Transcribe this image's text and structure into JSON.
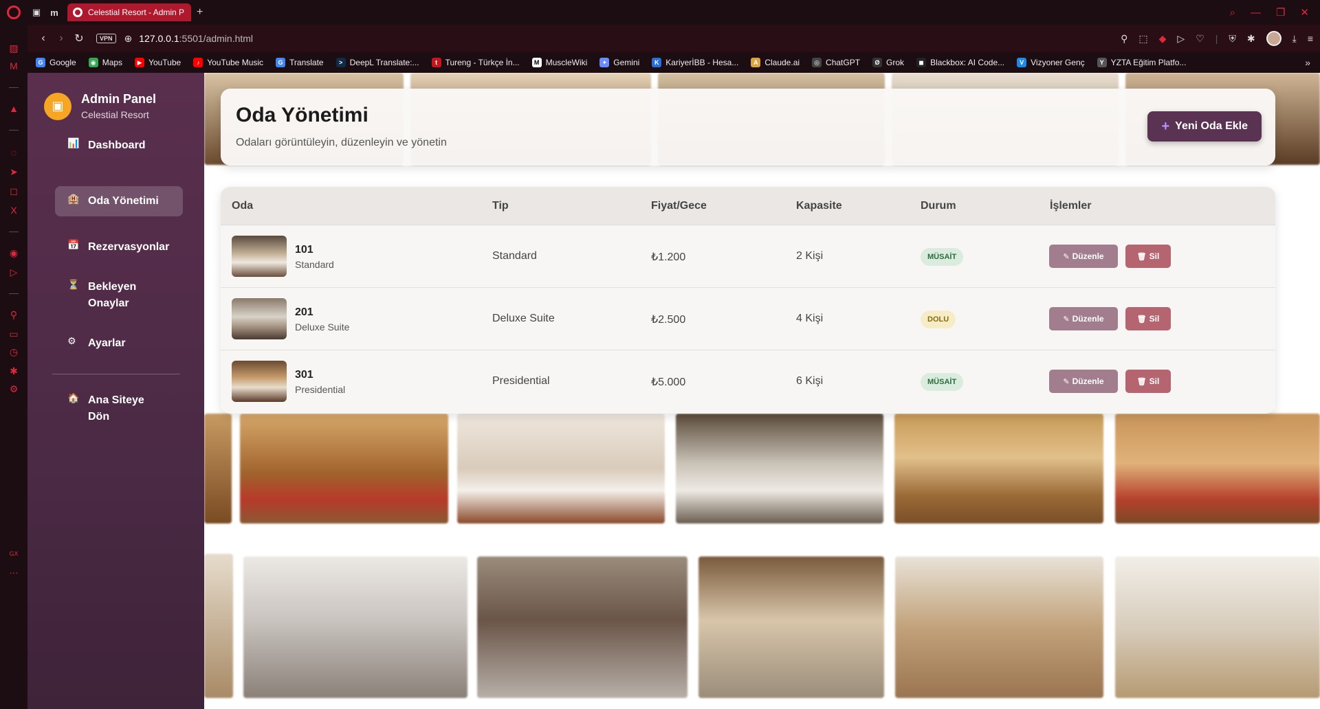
{
  "browser": {
    "tab_title": "Celestial Resort - Admin P",
    "url_host": "127.0.0.1",
    "url_rest": ":5501/admin.html",
    "vpn_label": "VPN",
    "bookmarks": [
      {
        "label": "Google",
        "color": "#4285f4",
        "glyph": "G"
      },
      {
        "label": "Maps",
        "color": "#34a853",
        "glyph": "◉"
      },
      {
        "label": "YouTube",
        "color": "#ff0000",
        "glyph": "▶"
      },
      {
        "label": "YouTube Music",
        "color": "#ff0000",
        "glyph": "♪"
      },
      {
        "label": "Translate",
        "color": "#4285f4",
        "glyph": "G"
      },
      {
        "label": "DeepL Translate:...",
        "color": "#0f2b46",
        "glyph": ">"
      },
      {
        "label": "Tureng - Türkçe İn...",
        "color": "#c4161c",
        "glyph": "t"
      },
      {
        "label": "MuscleWiki",
        "color": "#ffffff",
        "glyph": "M"
      },
      {
        "label": "Gemini",
        "color": "#6a8cff",
        "glyph": "✦"
      },
      {
        "label": "KariyerİBB - Hesa...",
        "color": "#2a6fd6",
        "glyph": "K"
      },
      {
        "label": "Claude.ai",
        "color": "#d9a441",
        "glyph": "A"
      },
      {
        "label": "ChatGPT",
        "color": "#444444",
        "glyph": "◎"
      },
      {
        "label": "Grok",
        "color": "#333333",
        "glyph": "Ø"
      },
      {
        "label": "Blackbox: AI Code...",
        "color": "#222222",
        "glyph": "◼"
      },
      {
        "label": "Vizyoner Genç",
        "color": "#1e88e5",
        "glyph": "V"
      },
      {
        "label": "YZTA Eğitim Platfo...",
        "color": "#555555",
        "glyph": "Y"
      }
    ]
  },
  "sidebar": {
    "title": "Admin Panel",
    "subtitle": "Celestial Resort",
    "items": [
      {
        "label": "Dashboard",
        "icon": "📊"
      },
      {
        "label": "Oda Yönetimi",
        "icon": "🏨"
      },
      {
        "label": "Rezervasyonlar",
        "icon": "📅"
      },
      {
        "label": "Bekleyen Onaylar",
        "icon": "⏳"
      },
      {
        "label": "Ayarlar",
        "icon": "⚙"
      },
      {
        "label": "Ana Siteye Dön",
        "icon": "🏠"
      }
    ]
  },
  "header": {
    "title": "Oda Yönetimi",
    "subtitle": "Odaları görüntüleyin, düzenleyin ve yönetin",
    "add_button": "Yeni Oda Ekle"
  },
  "table": {
    "columns": [
      "Oda",
      "Tip",
      "Fiyat/Gece",
      "Kapasite",
      "Durum",
      "İşlemler"
    ],
    "rows": [
      {
        "number": "101",
        "sub": "Standard",
        "type": "Standard",
        "price": "₺1.200",
        "capacity": "2 Kişi",
        "status": "MÜSAİT",
        "status_kind": "ok"
      },
      {
        "number": "201",
        "sub": "Deluxe Suite",
        "type": "Deluxe Suite",
        "price": "₺2.500",
        "capacity": "4 Kişi",
        "status": "DOLU",
        "status_kind": "busy"
      },
      {
        "number": "301",
        "sub": "Presidential",
        "type": "Presidential",
        "price": "₺5.000",
        "capacity": "6 Kişi",
        "status": "MÜSAİT",
        "status_kind": "ok"
      }
    ],
    "edit_label": "Düzenle",
    "delete_label": "Sil"
  }
}
